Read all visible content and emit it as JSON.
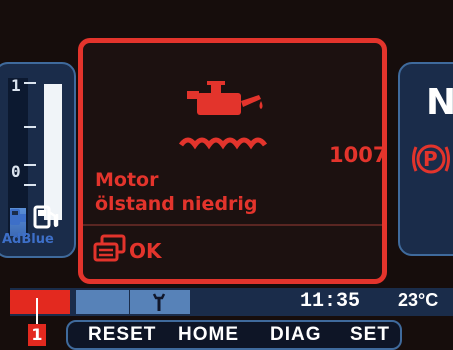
{
  "fuel_gauge": {
    "tick_top": "1",
    "tick_bottom": "0",
    "adblue_label": "AdBlue",
    "adblue_level": 0.18,
    "fuel_pump_icon": "fuel-pump-icon"
  },
  "gear_panel": {
    "gear": "N",
    "parking_brake_icon": "parking-brake-icon",
    "parking_brake_label": "P"
  },
  "warning": {
    "icon": "oil-level-icon",
    "code": "1007",
    "line1": "Motor",
    "line2": "ölstand niedrig",
    "ok_icon": "ok-cards-icon",
    "ok_label": "OK",
    "color": "#e3342c"
  },
  "status": {
    "page": "1",
    "wrench_icon": "wrench-icon",
    "time": "11:35",
    "temperature": "23°C"
  },
  "menu": {
    "reset": "RESET",
    "home": "HOME",
    "diag": "DIAG",
    "set": "SET"
  }
}
